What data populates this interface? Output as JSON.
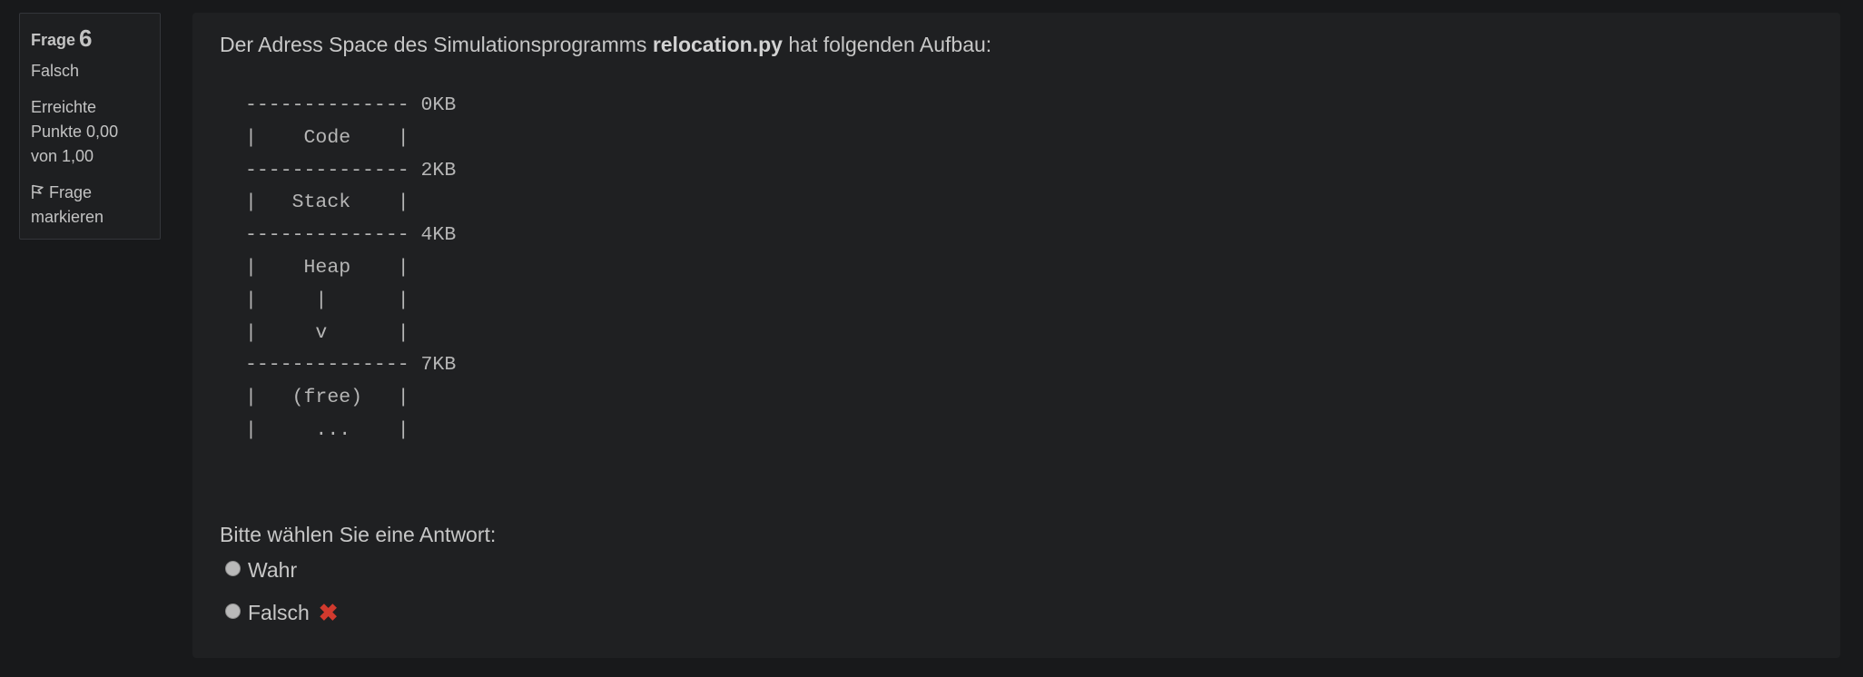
{
  "question_info": {
    "label": "Frage",
    "number": "6",
    "state": "Falsch",
    "grade": "Erreichte Punkte 0,00 von 1,00",
    "flag_label": "Frage markieren"
  },
  "question": {
    "text_before": "Der Adress Space des Simulationsprogramms ",
    "filename": "relocation.py",
    "text_after": " hat folgenden Aufbau:",
    "diagram": "-------------- 0KB\n|    Code    |\n-------------- 2KB\n|   Stack    |\n-------------- 4KB\n|    Heap    |\n|     |      |\n|     v      |\n-------------- 7KB\n|   (free)   |\n|     ...    |",
    "prompt": "Bitte wählen Sie eine Antwort:",
    "answers": [
      {
        "label": "Wahr",
        "selected": false
      },
      {
        "label": "Falsch",
        "selected": false,
        "marked_wrong": true
      }
    ]
  },
  "colors": {
    "page_background": "#18191b",
    "panel_background": "#1f2022",
    "wrong_mark": "#d13a2e"
  },
  "icons": {
    "flag": "flag-icon",
    "incorrect": "cross-icon"
  }
}
